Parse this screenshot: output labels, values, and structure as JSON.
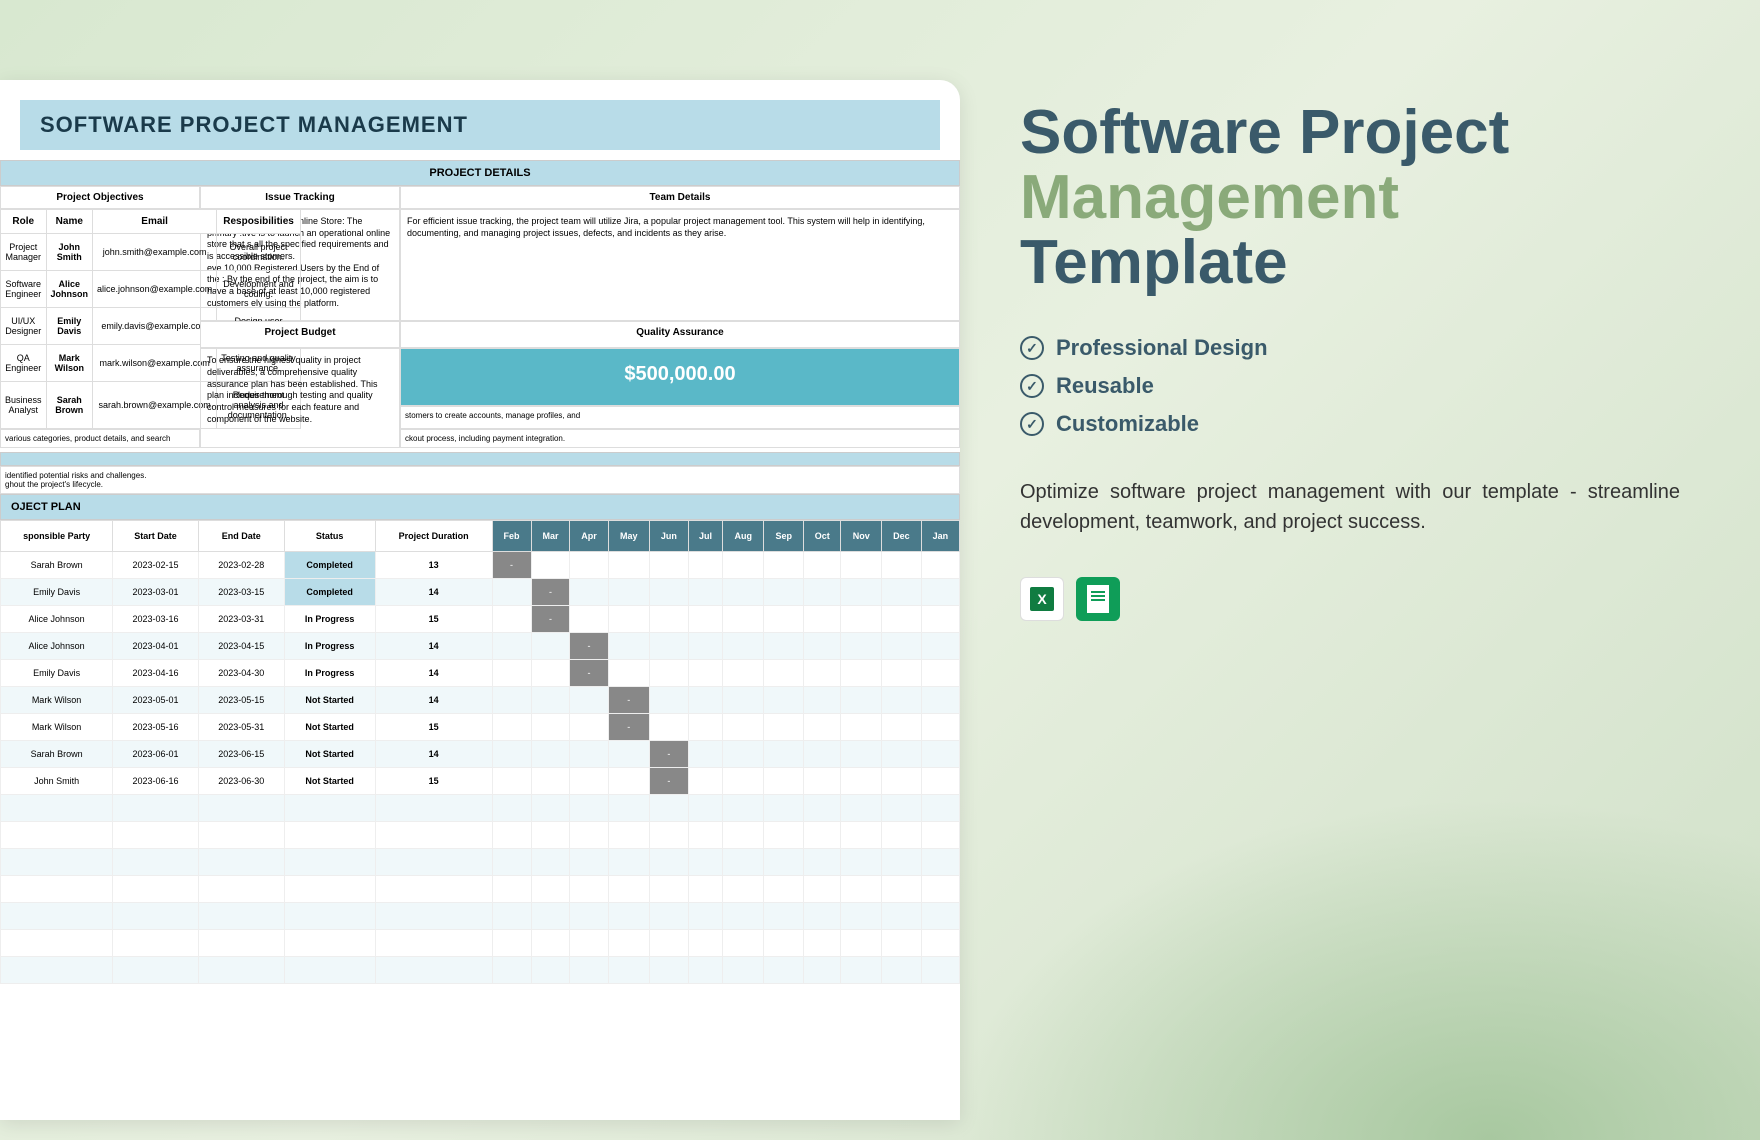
{
  "sheet": {
    "title": "SOFTWARE PROJECT MANAGEMENT",
    "section1": "PROJECT DETAILS",
    "headers": {
      "objectives": "Project Objectives",
      "tracking": "Issue Tracking",
      "teamDetails": "Team Details",
      "budget": "Project Budget",
      "qa": "Quality Assurance",
      "role": "Role",
      "name": "Name",
      "email": "Email",
      "resp": "Resposibilities"
    },
    "objectives_text": "ch a Fully Functional Online Store: The primary :tive is to launch an operational online store that s all the specified requirements and is accessible stomers.\neve 10,000 Registered Users by the End of the : By the end of the project, the aim is to have a base of at least 10,000 registered customers ely using the platform.",
    "tracking_text": "For efficient issue tracking, the project team will utilize Jira, a popular project management tool. This system will help in identifying, documenting, and managing project issues, defects, and incidents as they arise.",
    "qa_text": "To ensure the highest quality in project deliverables, a comprehensive quality assurance plan has been established. This plan includes thorough testing and quality control measures for each feature and component of the website.",
    "budget": "$500,000.00",
    "feat1": "stomers to create accounts, manage profiles, and",
    "feat2": "various categories, product details, and search",
    "feat3": "ckout process, including payment integration.",
    "risk": " identified potential risks and challenges.\nghout the project's lifecycle.",
    "team": [
      {
        "role": "Project Manager",
        "name": "John Smith",
        "email": "john.smith@example.com",
        "resp": "Overall project coordination."
      },
      {
        "role": "Software Engineer",
        "name": "Alice Johnson",
        "email": "alice.johnson@example.com",
        "resp": "Development and coding."
      },
      {
        "role": "UI/UX Designer",
        "name": "Emily Davis",
        "email": "emily.davis@example.com",
        "resp": "Design user interfaces."
      },
      {
        "role": "QA Engineer",
        "name": "Mark Wilson",
        "email": "mark.wilson@example.com",
        "resp": "Testing and quality assurance."
      },
      {
        "role": "Business Analyst",
        "name": "Sarah Brown",
        "email": "sarah.brown@example.com",
        "resp": "Requirement analysis and documentation."
      }
    ],
    "plan_title": "OJECT PLAN",
    "plan_headers": {
      "party": "sponsible Party",
      "start": "Start Date",
      "end": "End Date",
      "status": "Status",
      "duration": "Project Duration"
    },
    "months": [
      "Feb",
      "Mar",
      "Apr",
      "May",
      "Jun",
      "Jul",
      "Aug",
      "Sep",
      "Oct",
      "Nov",
      "Dec",
      "Jan"
    ],
    "tasks": [
      {
        "party": "Sarah Brown",
        "start": "2023-02-15",
        "end": "2023-02-28",
        "status": "Completed",
        "dur": "13",
        "m": 0
      },
      {
        "party": "Emily Davis",
        "start": "2023-03-01",
        "end": "2023-03-15",
        "status": "Completed",
        "dur": "14",
        "m": 1
      },
      {
        "party": "Alice Johnson",
        "start": "2023-03-16",
        "end": "2023-03-31",
        "status": "In Progress",
        "dur": "15",
        "m": 1
      },
      {
        "party": "Alice Johnson",
        "start": "2023-04-01",
        "end": "2023-04-15",
        "status": "In Progress",
        "dur": "14",
        "m": 2
      },
      {
        "party": "Emily Davis",
        "start": "2023-04-16",
        "end": "2023-04-30",
        "status": "In Progress",
        "dur": "14",
        "m": 2
      },
      {
        "party": "Mark Wilson",
        "start": "2023-05-01",
        "end": "2023-05-15",
        "status": "Not Started",
        "dur": "14",
        "m": 3
      },
      {
        "party": "Mark Wilson",
        "start": "2023-05-16",
        "end": "2023-05-31",
        "status": "Not Started",
        "dur": "15",
        "m": 3
      },
      {
        "party": "Sarah Brown",
        "start": "2023-06-01",
        "end": "2023-06-15",
        "status": "Not Started",
        "dur": "14",
        "m": 4
      },
      {
        "party": "John Smith",
        "start": "2023-06-16",
        "end": "2023-06-30",
        "status": "Not Started",
        "dur": "15",
        "m": 4
      }
    ]
  },
  "product": {
    "t1": "Software Project",
    "t2": "Management",
    "t3": "Template",
    "features": [
      "Professional Design",
      "Reusable",
      "Customizable"
    ],
    "desc": "Optimize software project management with our template - streamline development, teamwork, and project success."
  }
}
